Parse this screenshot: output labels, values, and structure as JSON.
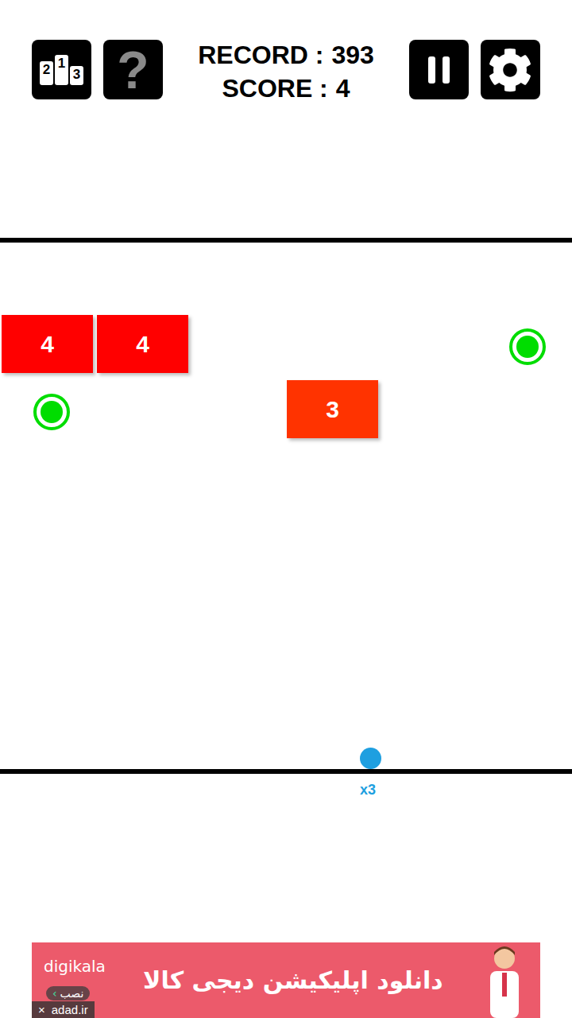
{
  "toolbar": {
    "podium_digits": [
      "2",
      "1",
      "3"
    ],
    "help": "?"
  },
  "record": {
    "label": "RECORD :",
    "value": "393"
  },
  "score": {
    "label": "SCORE :",
    "value": "4"
  },
  "blocks": [
    {
      "value": "4",
      "color": "#ff0000"
    },
    {
      "value": "4",
      "color": "#ff0000"
    },
    {
      "value": "3",
      "color": "#ff3300"
    }
  ],
  "pickups": [
    {
      "color": "#00dd00"
    },
    {
      "color": "#00dd00"
    }
  ],
  "ball": {
    "multiplier": "x3",
    "color": "#1e9fe0"
  },
  "ad": {
    "brand": "digikala",
    "text": "دانلود اپلیکیشن دیجی کالا",
    "install": "نصب",
    "close": "×",
    "network": "adad.ir"
  }
}
